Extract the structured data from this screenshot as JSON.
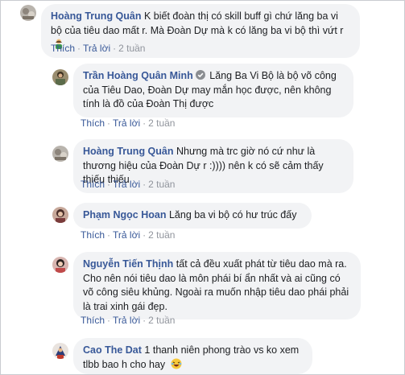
{
  "comments": [
    {
      "author": "Hoàng Trung Quân",
      "text": "K biết đoàn thị có skill buff gì chứ lăng ba vi bộ của tiêu dao mất r. Mà Đoàn Dự mà k có lăng ba vi bộ thì vứt r",
      "emoji": "man-icon",
      "like": "Thích",
      "reply": "Trả lời",
      "time": "2 tuần"
    },
    {
      "author": "Trần Hoàng Quân Minh",
      "verified": true,
      "text": "Lăng Ba Vi Bộ là bộ võ công của Tiêu Dao, Đoàn Dự may mắn học được, nên không tính là đồ của Đoàn Thị được",
      "like": "Thích",
      "reply": "Trả lời",
      "time": "2 tuần"
    },
    {
      "author": "Hoàng Trung Quân",
      "text": "Nhưng mà trc giờ nó cứ như là thương hiệu của Đoàn Dự r :)))) nên k có sẽ cảm thấy thiếu thiếu",
      "like": "Thích",
      "reply": "Trả lời",
      "time": "2 tuần"
    },
    {
      "author": "Phạm Ngọc Hoan",
      "text": "Lăng ba vi bộ có hư trúc đấy",
      "like": "Thích",
      "reply": "Trả lời",
      "time": "2 tuần"
    },
    {
      "author": "Nguyễn Tiến Thịnh",
      "text": "tất cả đều xuất phát từ tiêu dao mà ra. Cho nên nói tiêu dao là môn phái bí ẩn nhất và ai cũng có võ công siêu khủng. Ngoài ra muốn nhập tiêu dao phái phải là trai xinh gái đẹp.",
      "like": "Thích",
      "reply": "Trả lời",
      "time": "2 tuần"
    },
    {
      "author": "Cao The Dat",
      "text": "1 thanh niên phong trào vs ko xem tlbb bao h cho hay",
      "emoji": "laughing-face-icon"
    }
  ]
}
